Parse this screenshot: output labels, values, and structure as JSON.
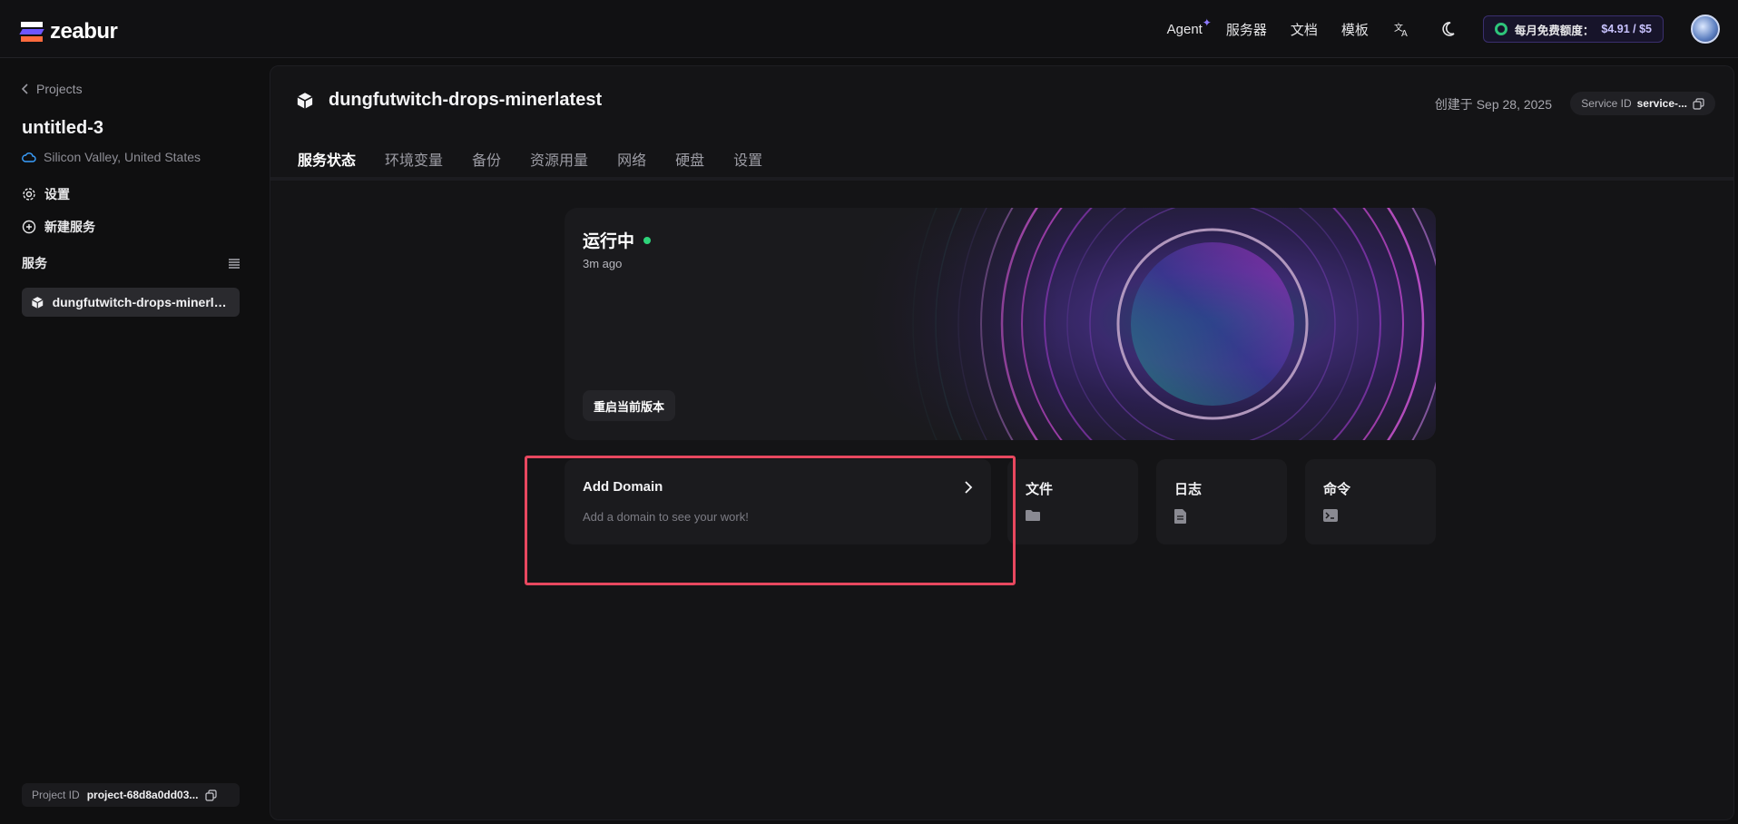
{
  "brand": {
    "name": "zeabur"
  },
  "topnav": {
    "agent": "Agent",
    "servers": "服务器",
    "docs": "文档",
    "templates": "模板",
    "quota_label": "每月免费额度：",
    "quota_value": "$4.91 / $5"
  },
  "sidebar": {
    "back": "Projects",
    "project_name": "untitled-3",
    "region": "Silicon Valley, United States",
    "settings": "设置",
    "new_service": "新建服务",
    "services_heading": "服务",
    "service_item": "dungfutwitch-drops-minerlat...",
    "project_id_label": "Project ID",
    "project_id_value": "project-68d8a0dd03..."
  },
  "service": {
    "name": "dungfutwitch-drops-minerlatest",
    "created": "创建于 Sep 28, 2025",
    "service_id_label": "Service ID",
    "service_id_value": "service-..."
  },
  "tabs": [
    "服务状态",
    "环境变量",
    "备份",
    "资源用量",
    "网络",
    "硬盘",
    "设置"
  ],
  "status": {
    "state": "运行中",
    "time": "3m ago",
    "restart": "重启当前版本"
  },
  "cards": {
    "domain_title": "Add Domain",
    "domain_sub": "Add a domain to see your work!",
    "files": "文件",
    "logs": "日志",
    "command": "命令"
  },
  "colors": {
    "accent": "#6e56ff",
    "running": "#2ed47a",
    "highlight": "#e8485f"
  }
}
